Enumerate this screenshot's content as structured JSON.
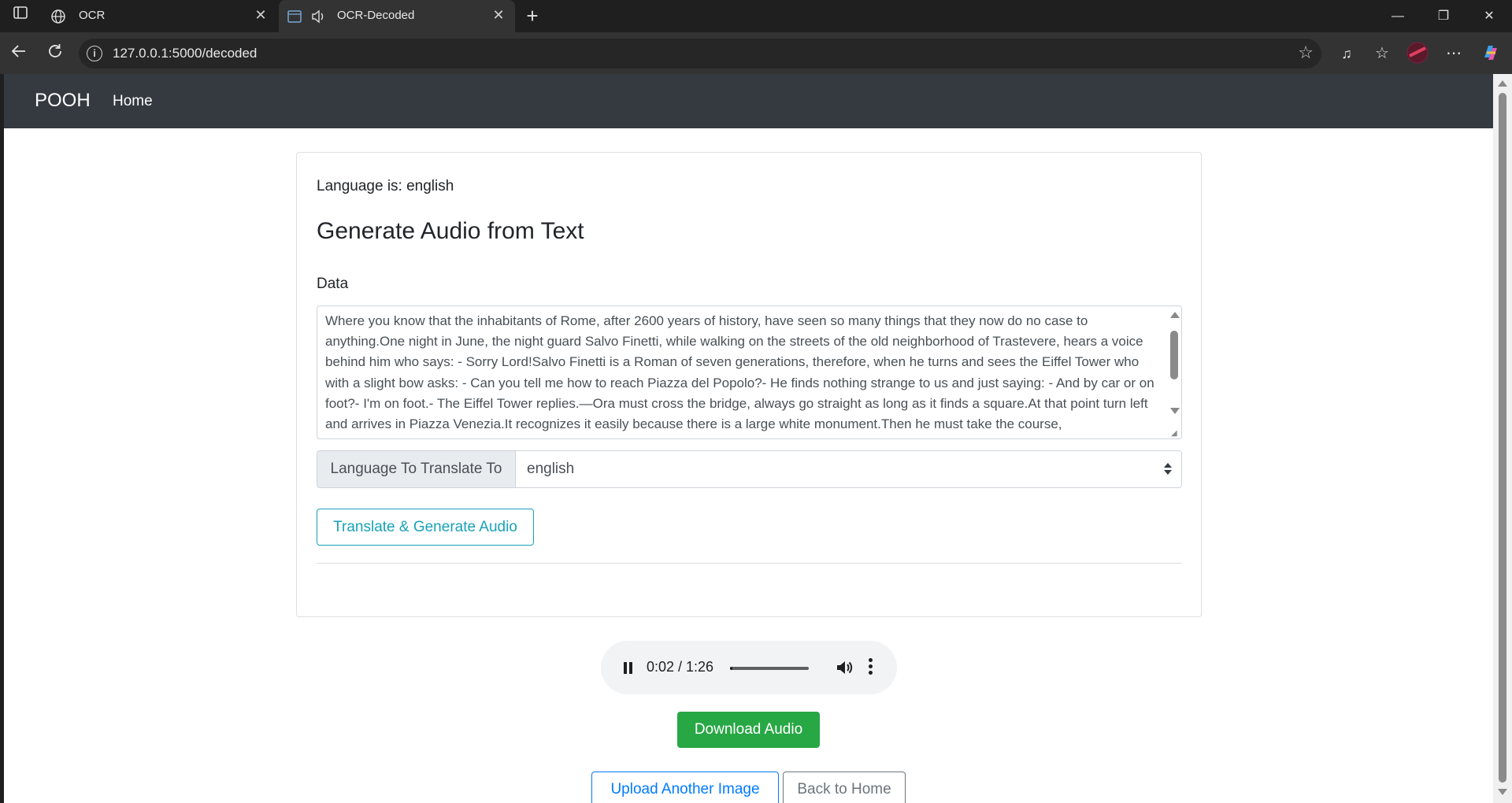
{
  "browser": {
    "tabs": [
      {
        "title": "OCR",
        "icon": "globe-icon",
        "active": false
      },
      {
        "title": "OCR-Decoded",
        "icon": "terminal-icon",
        "active": true,
        "audio_icon": "speaker-icon"
      }
    ],
    "url": "127.0.0.1:5000/decoded"
  },
  "navbar": {
    "brand": "POOH",
    "links": [
      "Home"
    ]
  },
  "card": {
    "language_line": "Language is: english",
    "title": "Generate Audio from Text",
    "data_label": "Data",
    "data_text": "Where you know that the inhabitants of Rome, after 2600 years of history, have seen so many things that they now do no case to anything.One night in June, the night guard Salvo Finetti, while walking on the streets of the old neighborhood of Trastevere, hears a voice behind him who says: - Sorry Lord!Salvo Finetti is a Roman of seven generations, therefore, when he turns and sees the Eiffel Tower who with a slight bow asks: - Can you tell me how to reach Piazza del Popolo?- He finds nothing strange to us and just saying: - And by car or on foot?- I'm on foot.- The Eiffel Tower replies.—Ora must cross the bridge, always go straight as long as it finds a square.At that point turn left and arrives in Piazza Venezia.It recognizes it easily because there is a large white monument.Then he must take the course,",
    "translate_label": "Language To Translate To",
    "translate_value": "english",
    "translate_button": "Translate & Generate Audio"
  },
  "audio": {
    "time": "0:02 / 1:26",
    "progress": 0.023
  },
  "buttons": {
    "download": "Download Audio",
    "upload_another": "Upload Another Image",
    "back_home": "Back to Home"
  },
  "colors": {
    "navbar": "#343a40",
    "info": "#17a2b8",
    "success": "#28a745",
    "primary": "#007bff",
    "secondary": "#6c757d"
  }
}
